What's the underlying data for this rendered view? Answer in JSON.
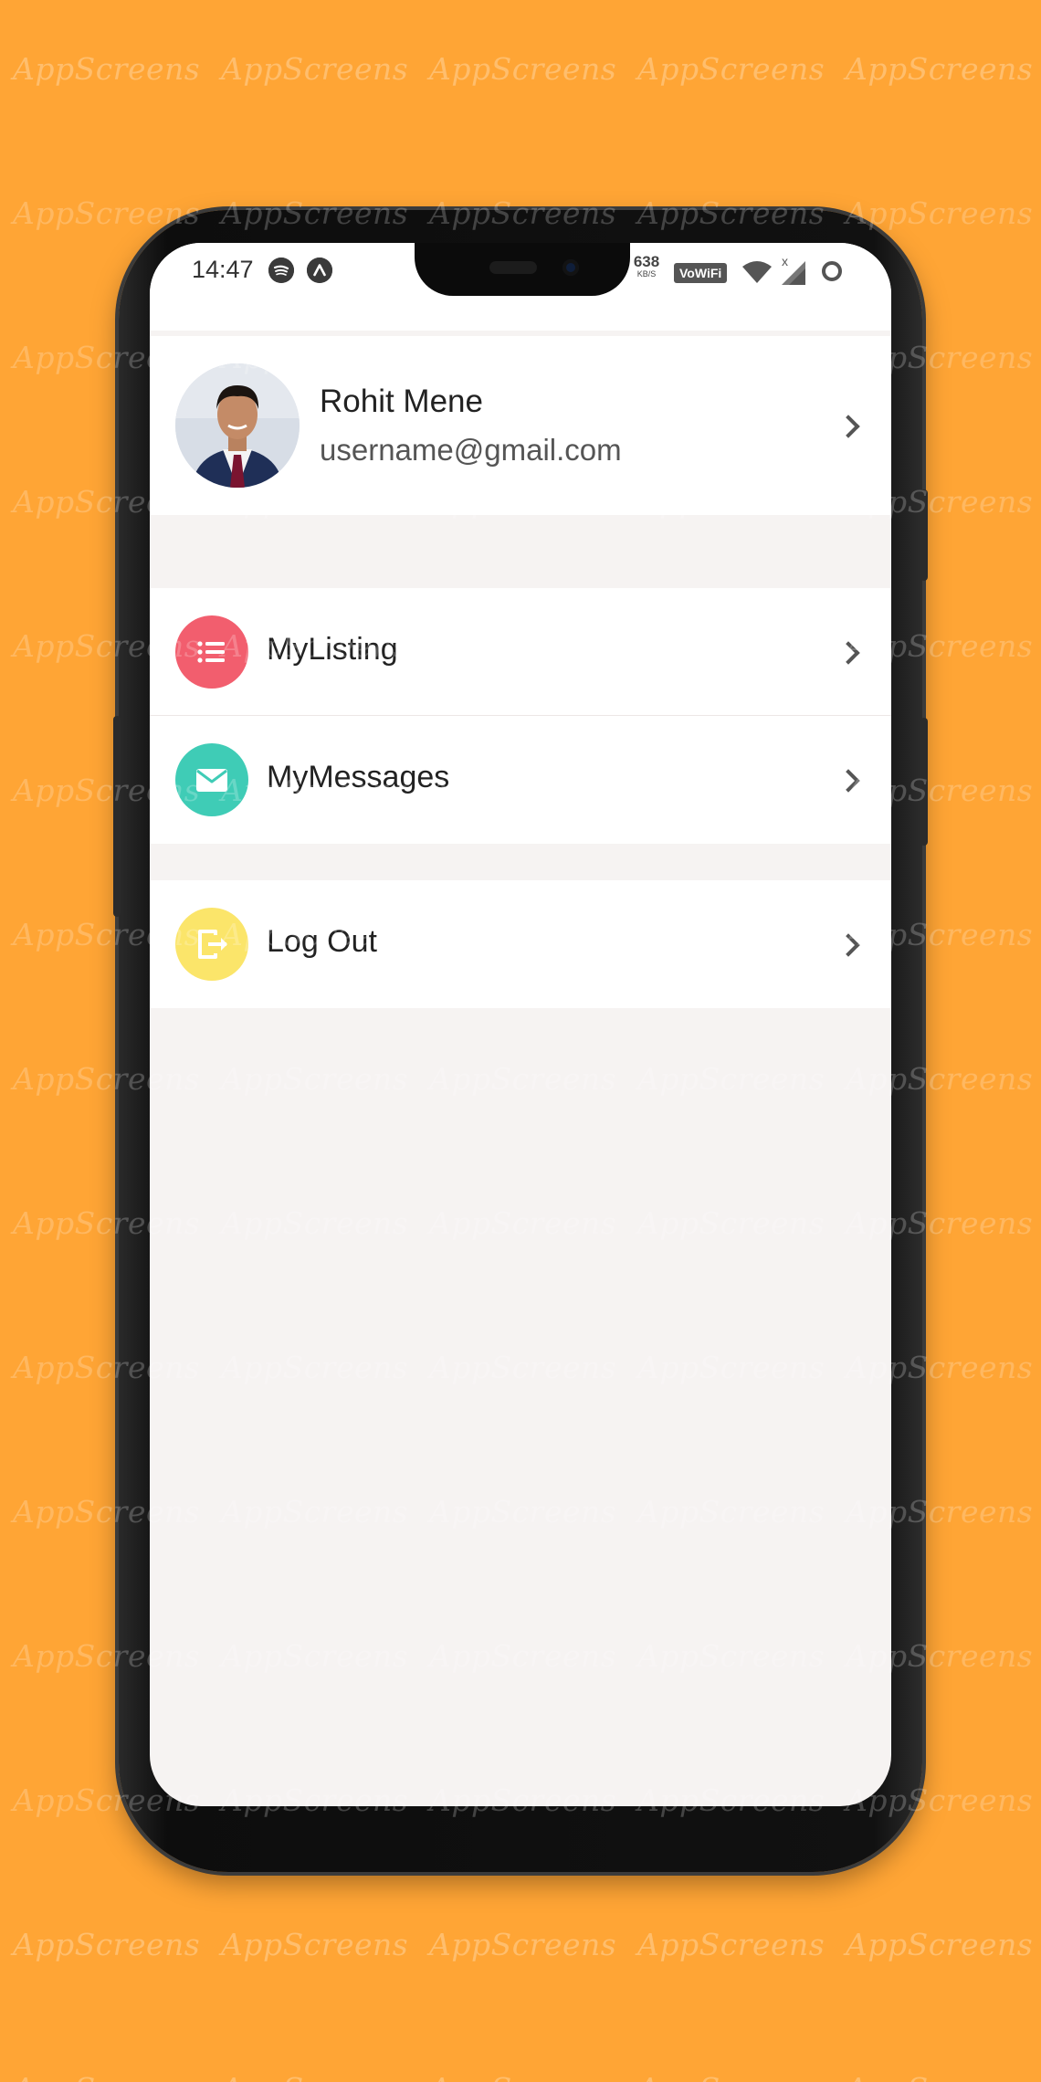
{
  "status_bar": {
    "time": "14:47",
    "net_speed_value": "638",
    "net_speed_unit": "KB/S",
    "wifi_label": "VoWiFi",
    "x_mark": "x"
  },
  "profile": {
    "name": "Rohit Mene",
    "email": "username@gmail.com"
  },
  "menu": [
    {
      "label": "MyListing",
      "icon": "list-icon",
      "color": "#F25E6E"
    },
    {
      "label": "MyMessages",
      "icon": "envelope-icon",
      "color": "#3FCCB6"
    },
    {
      "label": "Log Out",
      "icon": "logout-icon",
      "color": "#FBE56A"
    }
  ],
  "watermark": "AppScreens",
  "colors": {
    "background": "#FFA535",
    "screen_bg": "#F6F3F2",
    "card_bg": "#FFFFFF"
  }
}
